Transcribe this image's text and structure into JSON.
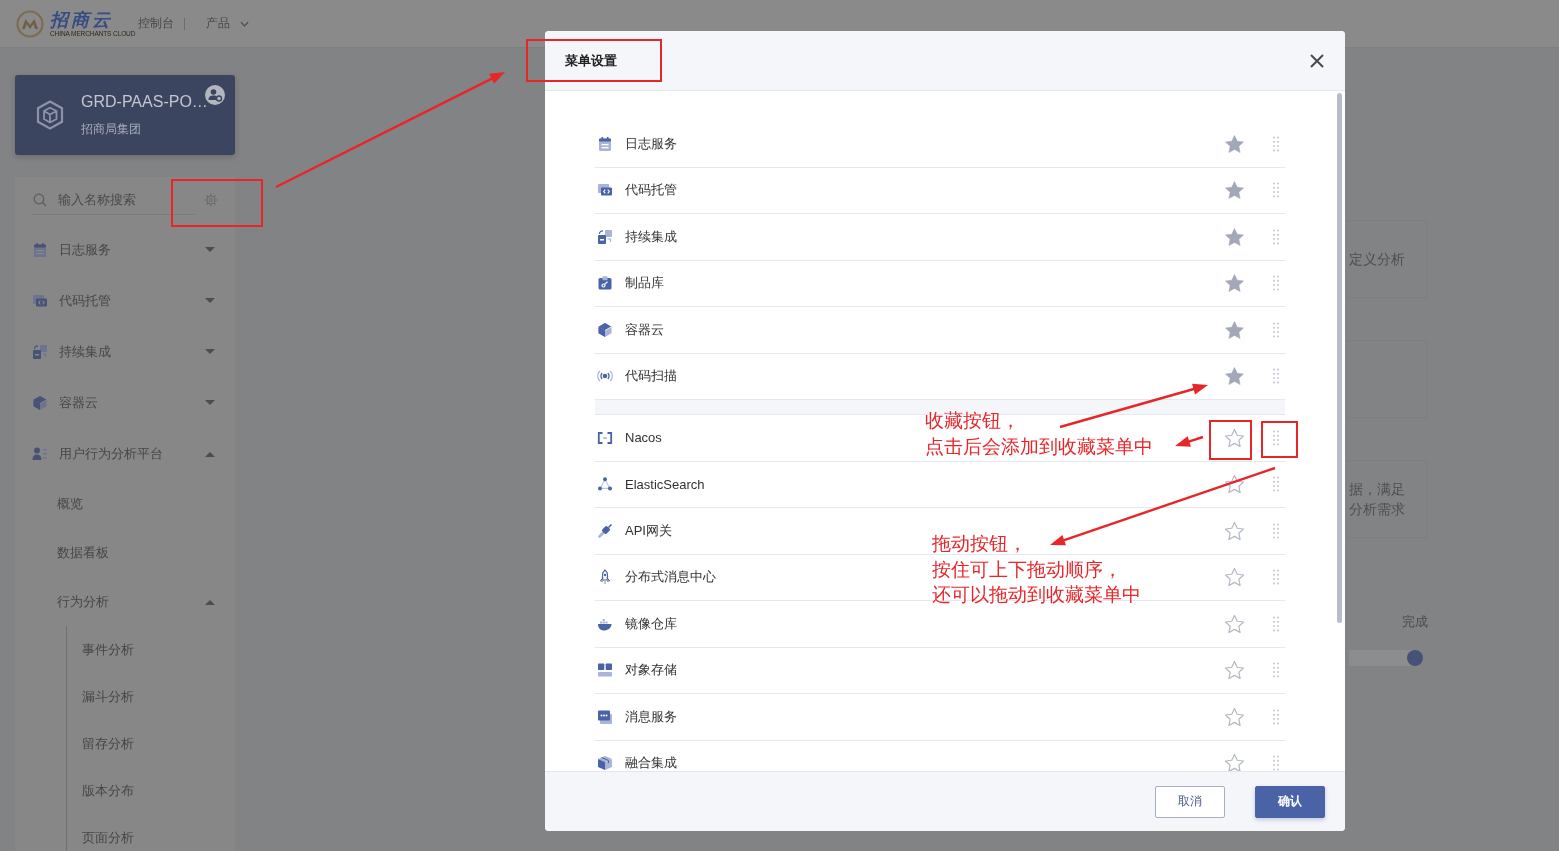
{
  "header": {
    "logo": {
      "name": "招商云",
      "tagline": "CHINA MERCHANTS CLOUD"
    },
    "nav": [
      {
        "label": "控制台",
        "kind": "link"
      },
      {
        "label": "产品",
        "kind": "dropdown"
      }
    ]
  },
  "sidebar": {
    "project": {
      "name": "GRD-PAAS-PO…",
      "org": "招商局集团"
    },
    "search": {
      "placeholder": "输入名称搜索"
    },
    "menu": [
      {
        "label": "日志服务",
        "expanded": false
      },
      {
        "label": "代码托管",
        "expanded": false
      },
      {
        "label": "持续集成",
        "expanded": false
      },
      {
        "label": "容器云",
        "expanded": false
      },
      {
        "label": "用户行为分析平台",
        "expanded": true,
        "children": [
          {
            "label": "概览"
          },
          {
            "label": "数据看板"
          },
          {
            "label": "行为分析",
            "expanded": true,
            "children": [
              {
                "label": "事件分析"
              },
              {
                "label": "漏斗分析"
              },
              {
                "label": "留存分析"
              },
              {
                "label": "版本分布"
              },
              {
                "label": "页面分析"
              }
            ]
          }
        ]
      }
    ]
  },
  "content": {
    "cards": [
      {
        "kind": "text",
        "lines": [
          "定义分析"
        ]
      },
      {
        "kind": "empty"
      },
      {
        "kind": "text",
        "lines": [
          "据，满足",
          "分析需求"
        ]
      }
    ],
    "progress": {
      "label": "完成",
      "level": 1
    }
  },
  "modal": {
    "title": "菜单设置",
    "groups": [
      {
        "items": [
          {
            "label": "日志服务",
            "starred": true
          },
          {
            "label": "代码托管",
            "starred": true
          },
          {
            "label": "持续集成",
            "starred": true
          },
          {
            "label": "制品库",
            "starred": true
          },
          {
            "label": "容器云",
            "starred": true
          },
          {
            "label": "代码扫描",
            "starred": true
          }
        ]
      },
      {
        "items": [
          {
            "label": "Nacos",
            "starred": false
          },
          {
            "label": "ElasticSearch",
            "starred": false
          },
          {
            "label": "API网关",
            "starred": false
          },
          {
            "label": "分布式消息中心",
            "starred": false
          },
          {
            "label": "镜像仓库",
            "starred": false
          },
          {
            "label": "对象存储",
            "starred": false
          },
          {
            "label": "消息服务",
            "starred": false
          },
          {
            "label": "融合集成",
            "starred": false
          }
        ]
      }
    ],
    "buttons": [
      {
        "label": "取消",
        "kind": "secondary"
      },
      {
        "label": "确认",
        "kind": "primary"
      }
    ]
  },
  "annotations": [
    {
      "lines": [
        "收藏按钮，",
        "点击后会添加到收藏菜单中"
      ]
    },
    {
      "lines": [
        "拖动按钮，",
        "按住可上下拖动顺序，",
        "还可以拖动到收藏菜单中"
      ]
    }
  ]
}
